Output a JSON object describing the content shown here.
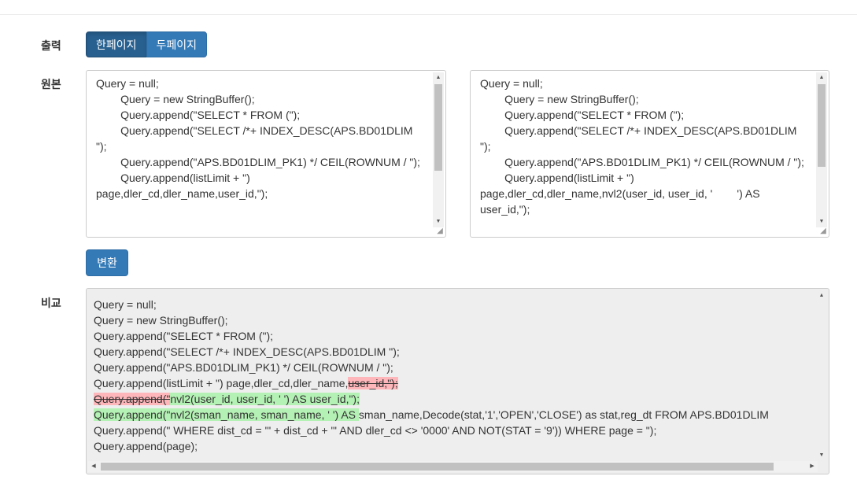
{
  "labels": {
    "output": "출력",
    "original": "원본",
    "compare": "비교"
  },
  "output_toggle": {
    "one_page": "한페이지",
    "two_page": "두페이지"
  },
  "left_text": "Query = null;\n\t\tQuery = new StringBuffer();\n\t\tQuery.append(\"SELECT * FROM (\");\n\t\tQuery.append(\"SELECT /*+ INDEX_DESC(APS.BD01DLIM \");\n\t\tQuery.append(\"APS.BD01DLIM_PK1) */ CEIL(ROWNUM / \");\n\t\tQuery.append(listLimit + \") page,dler_cd,dler_name,user_id,\");\n",
  "right_text": "Query = null;\n\t\tQuery = new StringBuffer();\n\t\tQuery.append(\"SELECT * FROM (\");\n\t\tQuery.append(\"SELECT /*+ INDEX_DESC(APS.BD01DLIM \");\n\t\tQuery.append(\"APS.BD01DLIM_PK1) */ CEIL(ROWNUM / \");\n\t\tQuery.append(listLimit + \") page,dler_cd,dler_name,nvl2(user_id, user_id, '        ') AS user_id,\");\n",
  "convert_label": "변환",
  "diff_lines": [
    [
      {
        "t": "Query = null;",
        "k": "eq"
      }
    ],
    [
      {
        "t": "Query = new StringBuffer();",
        "k": "eq"
      }
    ],
    [
      {
        "t": "Query.append(\"SELECT * FROM (\");",
        "k": "eq"
      }
    ],
    [
      {
        "t": "Query.append(\"SELECT /*+ INDEX_DESC(APS.BD01DLIM \");",
        "k": "eq"
      }
    ],
    [
      {
        "t": "Query.append(\"APS.BD01DLIM_PK1) */ CEIL(ROWNUM / \");",
        "k": "eq"
      }
    ],
    [
      {
        "t": "Query.append(listLimit + \") page,dler_cd,dler_name,",
        "k": "eq"
      },
      {
        "t": "user_id,\");",
        "k": "del"
      }
    ],
    [
      {
        "t": "Query.append(\"",
        "k": "del"
      },
      {
        "t": "nvl2(user_id, user_id, '        ') AS user_id,\");",
        "k": "ins"
      }
    ],
    [
      {
        "t": "Query.append(\"nvl2(sman_name, sman_name, '                    ') AS ",
        "k": "ins"
      },
      {
        "t": "sman_name,Decode(stat,'1','OPEN','CLOSE') as stat,reg_dt FROM APS.BD01DLIM",
        "k": "eq"
      }
    ],
    [
      {
        "t": "Query.append(\" WHERE dist_cd = '\" + dist_cd + \"'  AND dler_cd <> '0000' AND NOT(STAT = '9')) WHERE page = \");",
        "k": "eq"
      }
    ],
    [
      {
        "t": "Query.append(page);",
        "k": "eq"
      }
    ]
  ]
}
